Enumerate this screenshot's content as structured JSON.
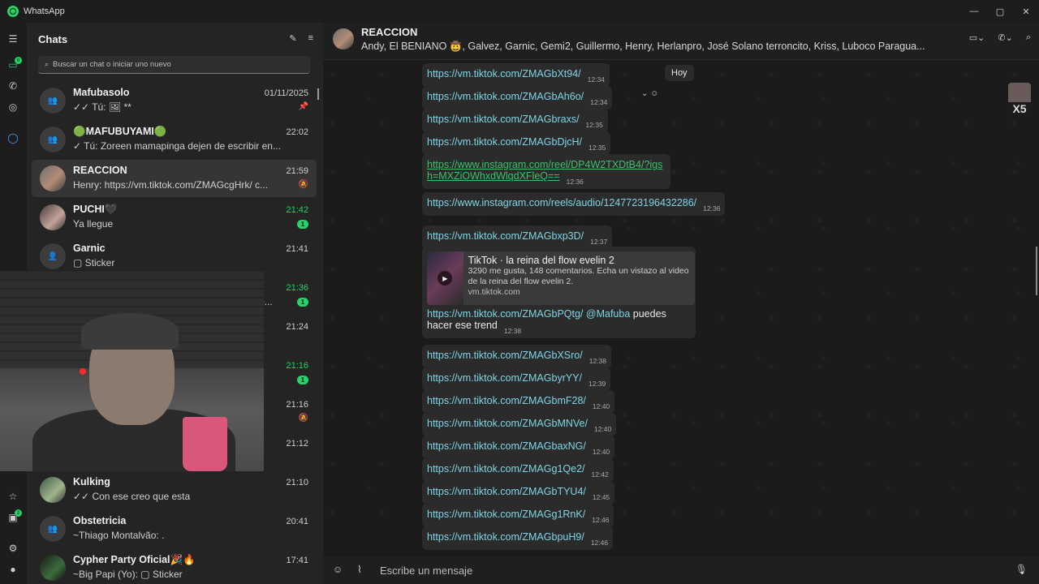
{
  "window": {
    "title": "WhatsApp"
  },
  "chat_list": {
    "title": "Chats",
    "search_placeholder": "Buscar un chat o iniciar uno nuevo",
    "chats": [
      {
        "name": "Mafubasolo",
        "time": "01/11/2025",
        "preview": "✓✓ Tú: 🖼 **",
        "pinned": true
      },
      {
        "name": "🟢MAFUBUYAMI🟢",
        "time": "22:02",
        "preview": "✓ Tú: Zoreen mamapinga dejen de escribir en..."
      },
      {
        "name": "REACCION",
        "time": "21:59",
        "preview": "Henry: https://vm.tiktok.com/ZMAGcgHrk/ c...",
        "muted": true,
        "active": true
      },
      {
        "name": "PUCHI🖤",
        "time": "21:42",
        "preview": "Ya llegue",
        "badge": "1"
      },
      {
        "name": "Garnic",
        "time": "21:41",
        "preview": "▢ Sticker"
      },
      {
        "name": "",
        "time": "21:36",
        "preview": "...arajo...",
        "badge": "1"
      },
      {
        "name": "",
        "time": "21:24",
        "preview": ""
      },
      {
        "name": "",
        "time": "21:16",
        "preview": "",
        "badge": "1"
      },
      {
        "name": "",
        "time": "21:16",
        "preview": "",
        "muted": true
      },
      {
        "name": "",
        "time": "21:12",
        "preview": ""
      },
      {
        "name": "Kulking",
        "time": "21:10",
        "preview": "✓✓ Con ese creo que esta"
      },
      {
        "name": "Obstetricia",
        "time": "20:41",
        "preview": "~Thiago Montalvão: ."
      },
      {
        "name": "Cypher Party Oficial🎉🔥",
        "time": "17:41",
        "preview": "~Big Papi (Yo): ▢ Sticker"
      }
    ]
  },
  "conversation": {
    "title": "REACCION",
    "members": "Andy, El BENIANO 🤠, Galvez, Garnic, Gemi2, Guillermo, Henry, Herlanpro, José Solano terroncito, Kriss, Luboco Paragua...",
    "date_chip": "Hoy",
    "sticker_text": "X5",
    "messages": [
      {
        "text": "https://vm.tiktok.com/ZMAGbXt94/",
        "time": "12:34"
      },
      {
        "text": "https://vm.tiktok.com/ZMAGbAh6o/",
        "time": "12:34"
      },
      {
        "text": "https://vm.tiktok.com/ZMAGbraxs/",
        "time": "12:35"
      },
      {
        "text": "https://vm.tiktok.com/ZMAGbDjcH/",
        "time": "12:35"
      },
      {
        "text": "https://www.instagram.com/reel/DP4W2TXDtB4/?igsh=MXZiOWhxdWlqdXFleQ==",
        "time": "12:36"
      },
      {
        "text": "https://www.instagram.com/reels/audio/1247723196432286/",
        "time": "12:36"
      },
      {
        "text": "https://vm.tiktok.com/ZMAGbxp3D/",
        "time": "12:37"
      },
      {
        "preview_title": "TikTok · la reina del flow evelin 2",
        "preview_desc": "3290 me gusta, 148 comentarios. Echa un vistazo al video de la reina del flow evelin 2.",
        "preview_domain": "vm.tiktok.com",
        "text": "https://vm.tiktok.com/ZMAGbPQtg/",
        "mention": "@Mafuba",
        "tail": "puedes hacer ese trend",
        "time": "12:38"
      },
      {
        "text": "https://vm.tiktok.com/ZMAGbXSro/",
        "time": "12:38"
      },
      {
        "text": "https://vm.tiktok.com/ZMAGbyrYY/",
        "time": "12:39"
      },
      {
        "text": "https://vm.tiktok.com/ZMAGbmF28/",
        "time": "12:40"
      },
      {
        "text": "https://vm.tiktok.com/ZMAGbMNVe/",
        "time": "12:40"
      },
      {
        "text": "https://vm.tiktok.com/ZMAGbaxNG/",
        "time": "12:40"
      },
      {
        "text": "https://vm.tiktok.com/ZMAGg1Qe2/",
        "time": "12:42"
      },
      {
        "text": "https://vm.tiktok.com/ZMAGbTYU4/",
        "time": "12:45"
      },
      {
        "text": "https://vm.tiktok.com/ZMAGg1RnK/",
        "time": "12:46"
      },
      {
        "text": "https://vm.tiktok.com/ZMAGbpuH9/",
        "time": "12:46"
      }
    ],
    "composer_placeholder": "Escribe un mensaje"
  }
}
